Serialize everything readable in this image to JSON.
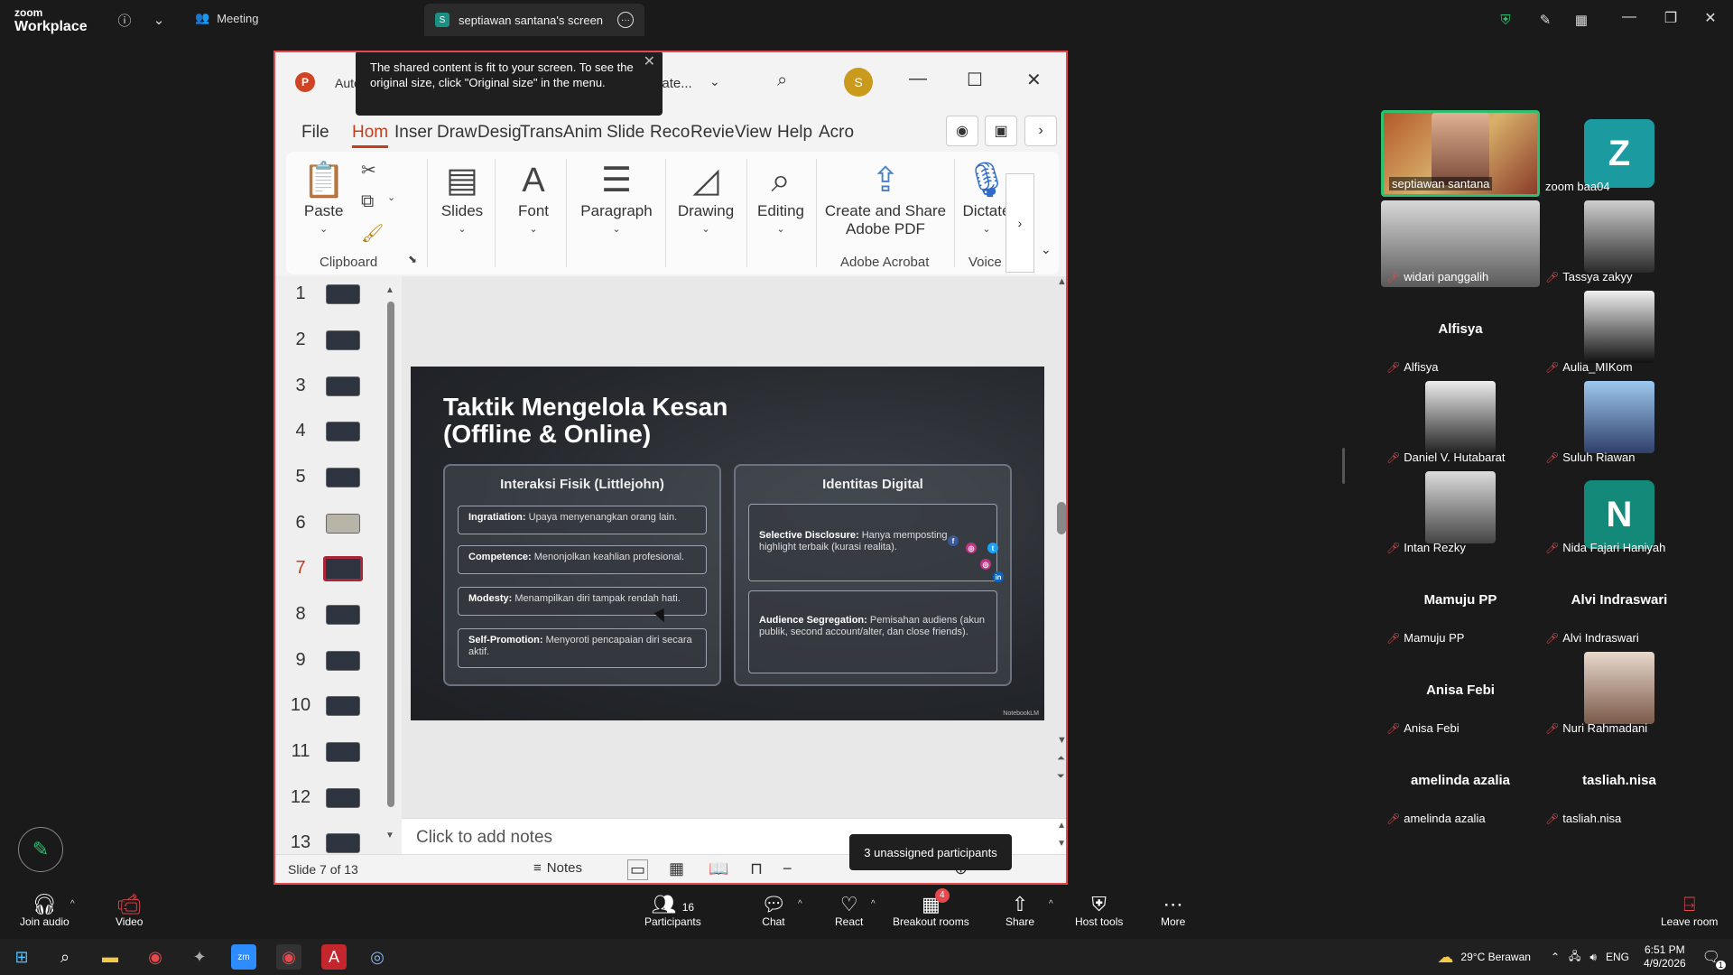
{
  "zoom": {
    "logo_top": "zoom",
    "logo_bottom": "Workplace",
    "meeting_tab": "Meeting",
    "screen_tab": "septiawan santana's screen",
    "screen_tab_badge": "S"
  },
  "toast": {
    "text": "The shared content is fit to your screen. To see the original size, click \"Original size\" in the menu."
  },
  "powerpoint": {
    "logo_letter": "P",
    "autosave_label": "Autos",
    "filename": "3b Mate...",
    "avatar_letter": "S",
    "tabs": [
      "File",
      "Hom",
      "Inser",
      "Draw",
      "Desig",
      "Trans",
      "Anim",
      "Slide",
      "Reco",
      "Revie",
      "View",
      "Help",
      "Acro"
    ],
    "active_tab": "Hom",
    "ribbon": {
      "paste": "Paste",
      "clipboard_group": "Clipboard",
      "slides": "Slides",
      "font": "Font",
      "paragraph": "Paragraph",
      "drawing": "Drawing",
      "editing": "Editing",
      "create_share_line1": "Create and Share",
      "create_share_line2": "Adobe PDF",
      "adobe_group": "Adobe Acrobat",
      "dictate": "Dictate",
      "voice_group": "Voice"
    },
    "thumbnails": [
      "1",
      "2",
      "3",
      "4",
      "5",
      "6",
      "7",
      "8",
      "9",
      "10",
      "11",
      "12",
      "13"
    ],
    "active_thumbnail": "7",
    "notes_placeholder": "Click to add notes",
    "status_slide": "Slide 7 of 13",
    "notes_button": "Notes"
  },
  "slide": {
    "title_line1": "Taktik Mengelola Kesan",
    "title_line2": "(Offline & Online)",
    "left_card_title": "Interaksi Fisik (Littlejohn)",
    "left_items": [
      {
        "term": "Ingratiation:",
        "desc": "Upaya menyenangkan orang lain."
      },
      {
        "term": "Competence:",
        "desc": "Menonjolkan keahlian profesional."
      },
      {
        "term": "Modesty:",
        "desc": "Menampilkan diri tampak rendah hati."
      },
      {
        "term": "Self-Promotion:",
        "desc": "Menyoroti pencapaian diri secara aktif."
      }
    ],
    "right_card_title": "Identitas Digital",
    "right_items": [
      {
        "term": "Selective Disclosure:",
        "desc": "Hanya memposting highlight terbaik (kurasi realita)."
      },
      {
        "term": "Audience Segregation:",
        "desc": "Pemisahan audiens (akun publik, second account/alter, dan close friends)."
      }
    ],
    "watermark": "NotebookLM"
  },
  "unassigned_tooltip": "3 unassigned participants",
  "participants": [
    {
      "name": "septiawan santana",
      "type": "video",
      "active": true,
      "muted": false
    },
    {
      "name": "zoom baa04",
      "type": "letter",
      "letter": "Z",
      "muted": false
    },
    {
      "name": "widari panggalih",
      "type": "video",
      "muted": true
    },
    {
      "name": "Tassya zakyy",
      "type": "photo",
      "muted": true
    },
    {
      "name": "Alfisya",
      "type": "name",
      "muted": true
    },
    {
      "name": "Aulia_MIKom",
      "type": "photo",
      "muted": true
    },
    {
      "name": "Daniel V. Hutabarat",
      "type": "photo",
      "muted": true
    },
    {
      "name": "Suluh Riawan",
      "type": "photo",
      "muted": true
    },
    {
      "name": "Intan Rezky",
      "type": "photo",
      "muted": true
    },
    {
      "name": "Nida Fajari Haniyah",
      "type": "letter",
      "letter": "N",
      "muted": true
    },
    {
      "name": "Mamuju PP",
      "type": "name",
      "muted": true
    },
    {
      "name": "Alvi Indraswari",
      "type": "name",
      "muted": true
    },
    {
      "name": "Anisa Febi",
      "type": "name",
      "muted": true
    },
    {
      "name": "Nuri Rahmadani",
      "type": "photo",
      "muted": true
    },
    {
      "name": "amelinda azalia",
      "type": "name",
      "muted": true
    },
    {
      "name": "tasliah.nisa",
      "type": "name",
      "muted": true
    }
  ],
  "toolbar": {
    "join_audio": "Join audio",
    "video": "Video",
    "participants": "Participants",
    "participants_count": "16",
    "chat": "Chat",
    "react": "React",
    "breakout_rooms": "Breakout rooms",
    "breakout_badge": "4",
    "share": "Share",
    "host_tools": "Host tools",
    "more": "More",
    "leave_room": "Leave room"
  },
  "taskbar": {
    "weather": "29°C Berawan",
    "language": "ENG",
    "time": "6:51 PM",
    "date": "4/9/2026",
    "notification_count": "1"
  },
  "colors": {
    "share_border": "#e5484d",
    "active_tab": "#c43e1c",
    "active_speaker": "#2fbf71",
    "letter_tile": "#1b9aa0"
  }
}
